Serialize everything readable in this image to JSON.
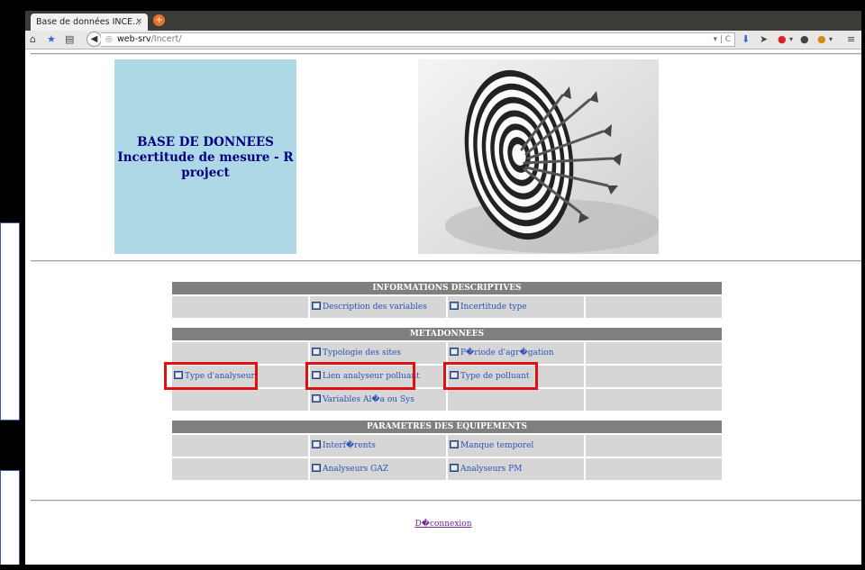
{
  "browser": {
    "tab_title": "Base de données INCE...",
    "tab_close": "×",
    "new_tab": "+",
    "url_host": "web-srv",
    "url_path": "/Incert/",
    "url_controls": "▾ | C"
  },
  "header": {
    "title_line1": "BASE DE DONNEES",
    "title_line2": "Incertitude de mesure - R",
    "title_line3": "project"
  },
  "sections": [
    {
      "title": "INFORMATIONS DESCRIPTIVES",
      "rows": [
        [
          "",
          "Description des variables",
          "Incertitude type",
          ""
        ]
      ]
    },
    {
      "title": "METADONNEES",
      "rows": [
        [
          "",
          "Typologie des sites",
          "P�riode d'agr�gation",
          ""
        ],
        [
          "Type d'analyseur",
          "Lien analyseur polluant",
          "Type de polluant",
          ""
        ],
        [
          "",
          "Variables Al�a ou Sys",
          "",
          ""
        ]
      ]
    },
    {
      "title": "PARAMETRES DES EQUIPEMENTS",
      "rows": [
        [
          "",
          "Interf�rents",
          "Manque temporel",
          ""
        ],
        [
          "",
          "Analyseurs GAZ",
          "Analyseurs PM",
          ""
        ]
      ]
    }
  ],
  "footer": {
    "logout_label": "D�connexion"
  },
  "colors": {
    "highlight": "#e01010",
    "section_header": "#7f7f7f",
    "cell_bg": "#d6d6d6",
    "title_box_bg": "#aed8e6",
    "title_text": "#000080",
    "link": "#2a52b8"
  }
}
